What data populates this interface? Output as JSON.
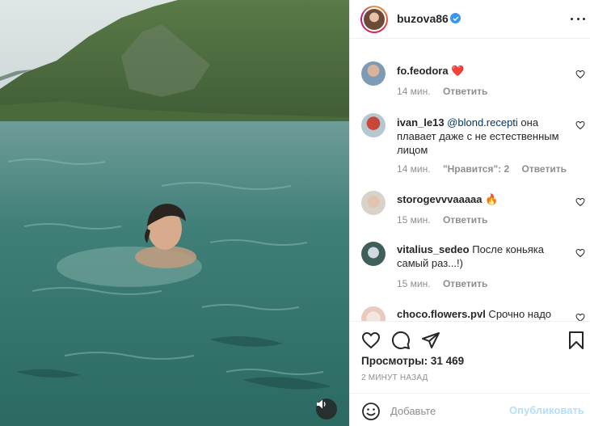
{
  "post": {
    "username": "buzova86",
    "verified": true
  },
  "comments": [
    {
      "user": "fo.feodora",
      "text": "",
      "emoji": "❤️",
      "time": "14 мин.",
      "likes": "",
      "reply": "Ответить"
    },
    {
      "user": "ivan_le13",
      "mention": "@blond.recepti",
      "text": " она плавает даже с не естественным лицом",
      "time": "14 мин.",
      "likes": "\"Нравится\": 2",
      "reply": "Ответить"
    },
    {
      "user": "storogevvvaaaaa",
      "text": "",
      "emoji": "🔥",
      "time": "15 мин.",
      "likes": "",
      "reply": "Ответить"
    },
    {
      "user": "vitalius_sedeo",
      "text": " После коньяка самый раз...!)",
      "time": "15 мин.",
      "likes": "",
      "reply": "Ответить"
    },
    {
      "user": "choco.flowers.pvl",
      "text": " Срочно надо",
      "time": "",
      "likes": "",
      "reply": ""
    }
  ],
  "stats": {
    "views": "Просмотры: 31 469",
    "time_ago": "2 МИНУТ НАЗАД"
  },
  "composer": {
    "placeholder": "Добавьте",
    "publish": "Опубликовать"
  },
  "icons": {
    "like": "heart-icon",
    "comment": "comment-icon",
    "share": "paper-plane-icon",
    "save": "bookmark-icon",
    "emoji": "smiley-icon",
    "sound": "speaker-icon",
    "more": "more-options-icon"
  },
  "colors": {
    "accent": "#3897f0",
    "publish_disabled": "#b2dffc",
    "mention": "#00376b"
  }
}
